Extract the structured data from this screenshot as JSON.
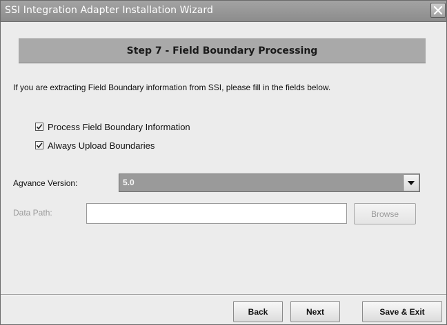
{
  "window": {
    "title": "SSI Integration Adapter Installation Wizard",
    "close_icon": "close-icon"
  },
  "step": {
    "title": "Step 7 - Field Boundary Processing"
  },
  "instructions": "If you are extracting Field Boundary information from SSI, please fill in the fields below.",
  "options": [
    {
      "label": "Process Field Boundary Information",
      "checked": true
    },
    {
      "label": "Always Upload Boundaries",
      "checked": true
    }
  ],
  "agvance_version": {
    "label": "Agvance Version:",
    "value": "5.0"
  },
  "data_path": {
    "label": "Data Path:",
    "value": "",
    "browse_label": "Browse",
    "enabled": false
  },
  "footer": {
    "back_label": "Back",
    "next_label": "Next",
    "save_exit_label": "Save & Exit"
  },
  "colors": {
    "title_bar": "#8c8c8c",
    "banner": "#a9a9a9",
    "combo_fill": "#9a9a9a",
    "window_bg": "#ececec"
  }
}
